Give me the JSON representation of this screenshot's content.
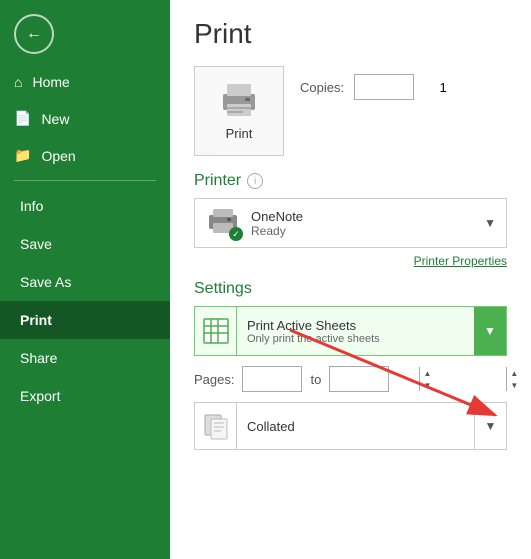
{
  "sidebar": {
    "back_icon": "←",
    "items": [
      {
        "id": "home",
        "label": "Home",
        "icon": "home"
      },
      {
        "id": "new",
        "label": "New",
        "icon": "new"
      },
      {
        "id": "open",
        "label": "Open",
        "icon": "open"
      }
    ],
    "text_items": [
      {
        "id": "info",
        "label": "Info",
        "active": false
      },
      {
        "id": "save",
        "label": "Save",
        "active": false
      },
      {
        "id": "save-as",
        "label": "Save As",
        "active": false
      },
      {
        "id": "print",
        "label": "Print",
        "active": true
      },
      {
        "id": "share",
        "label": "Share",
        "active": false
      },
      {
        "id": "export",
        "label": "Export",
        "active": false
      }
    ]
  },
  "main": {
    "title": "Print",
    "copies_label": "Copies:",
    "copies_value": "1",
    "printer_section": "Printer",
    "printer_info_icon": "ⓘ",
    "printer_name": "OneNote",
    "printer_status": "Ready",
    "printer_properties": "Printer Properties",
    "settings_section": "Settings",
    "settings_option": "Print Active Sheets",
    "settings_sub": "Only print the active sheets",
    "pages_label": "Pages:",
    "pages_to": "to",
    "collated_label": "Collated"
  }
}
